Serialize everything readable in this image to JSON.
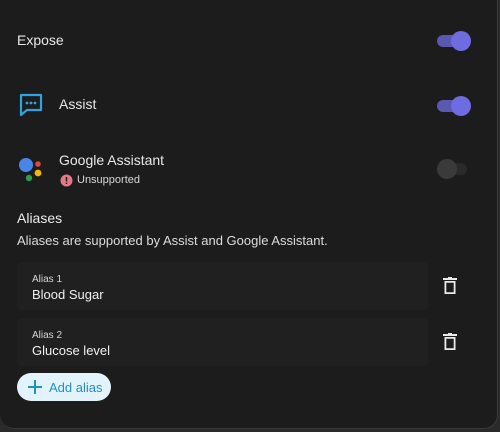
{
  "expose": {
    "label": "Expose",
    "enabled": true
  },
  "assistants": [
    {
      "label": "Assist",
      "icon": "speech-bubble-icon",
      "enabled": true
    },
    {
      "label": "Google Assistant",
      "icon": "google-assistant-icon",
      "status": "Unsupported",
      "enabled": false
    }
  ],
  "aliases": {
    "title": "Aliases",
    "description": "Aliases are supported by Assist and Google Assistant.",
    "items": [
      {
        "label": "Alias 1",
        "value": "Blood Sugar"
      },
      {
        "label": "Alias 2",
        "value": "Glucose level"
      }
    ],
    "add_label": "Add alias"
  },
  "colors": {
    "accent": "#6f6be0",
    "add_button_bg": "#e3f3fb",
    "add_button_text": "#1f8fc8",
    "warning": "#e07a86"
  }
}
